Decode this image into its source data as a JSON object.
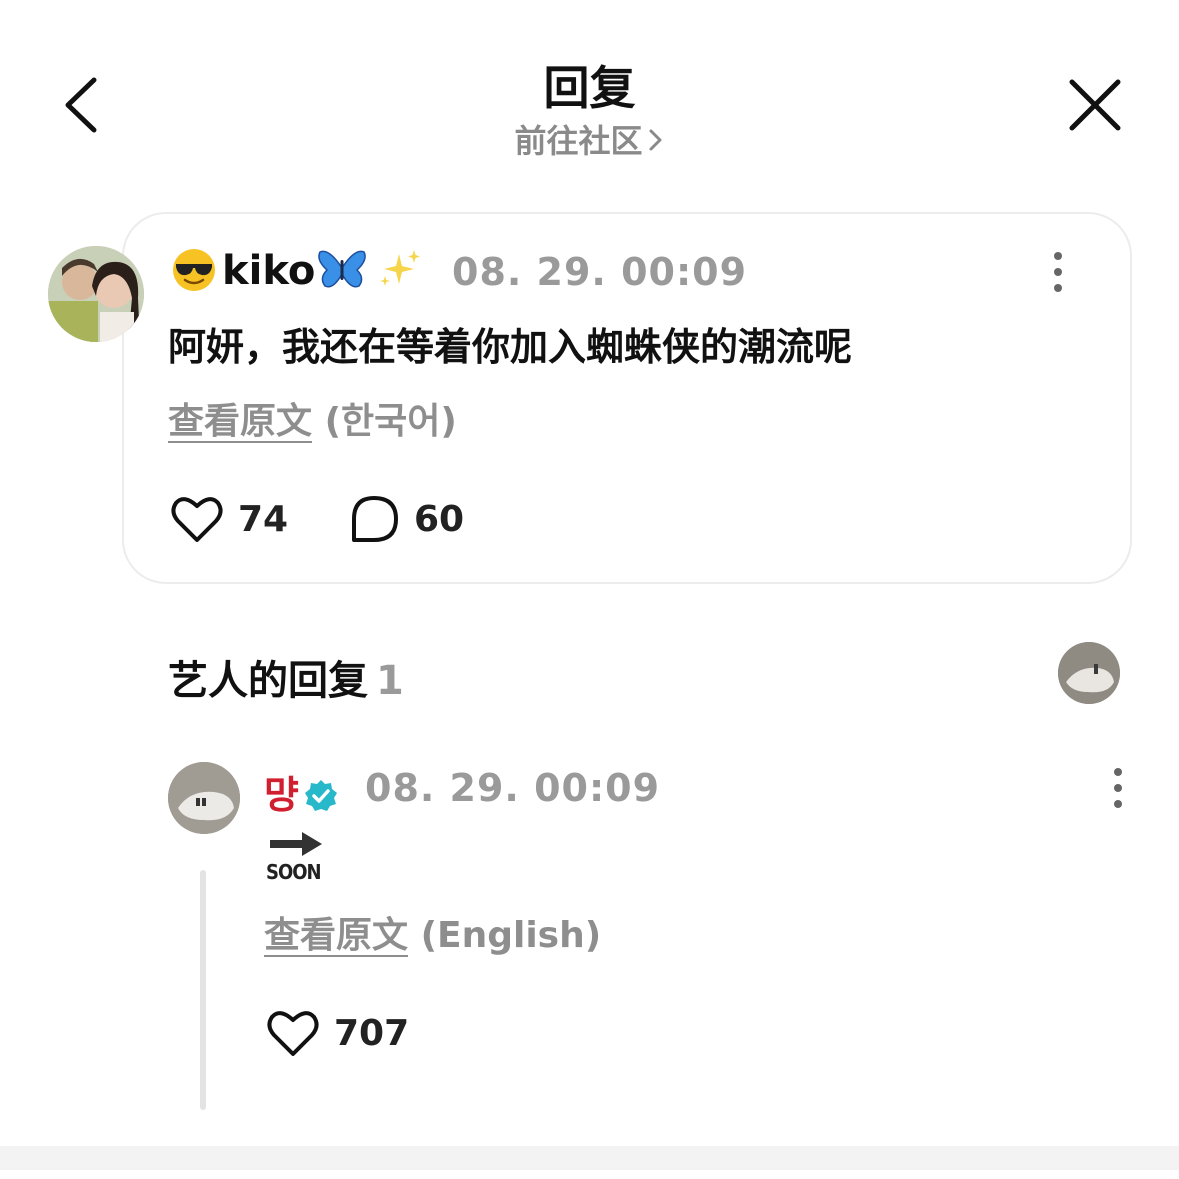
{
  "header": {
    "title": "回复",
    "subtitle": "前往社区"
  },
  "post": {
    "username": "kiko",
    "timestamp": "08. 29. 00:09",
    "text": "阿妍，我还在等着你加入蜘蛛侠的潮流呢",
    "translate_link": "查看原文",
    "translate_lang": "(한국어)",
    "likes": "74",
    "comments": "60"
  },
  "artist_replies": {
    "title": "艺人的回复",
    "count": "1"
  },
  "reply": {
    "username": "먕",
    "timestamp": "08. 29. 00:09",
    "soon_label": "SOON",
    "translate_link": "查看原文",
    "translate_lang": "(English)",
    "likes": "707"
  },
  "colors": {
    "accent_red": "#d21f2f",
    "verified_teal": "#27b8c9",
    "muted": "#9a9a9a"
  },
  "icons": [
    "back-icon",
    "close-icon",
    "chevron-right-icon",
    "more-icon",
    "heart-icon",
    "comment-icon",
    "verified-icon",
    "soon-arrow-icon"
  ]
}
